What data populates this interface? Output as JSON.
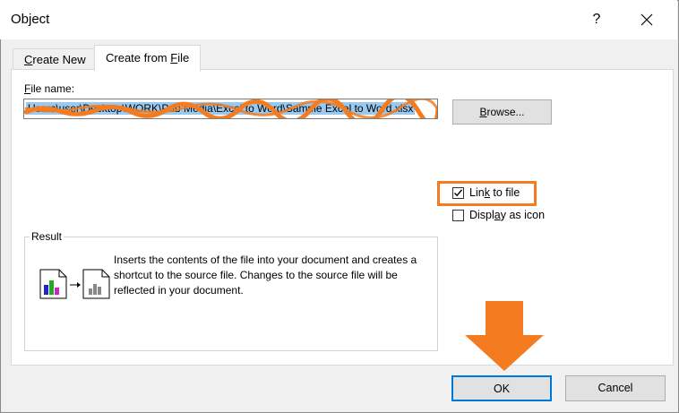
{
  "window": {
    "title": "Object",
    "help_label": "?",
    "close_icon": "close-icon"
  },
  "tabs": [
    {
      "label": "Create New",
      "accel": "C",
      "rest": "reate New",
      "active": false
    },
    {
      "label": "Create from File",
      "accel_pre": "Create from ",
      "accel": "F",
      "rest": "ile",
      "active": true
    }
  ],
  "file": {
    "label_pre": "",
    "label_accel": "F",
    "label_rest": "ile name:",
    "value": "Users\\user\\Desktop\\WORK\\Pub Media\\Excel to Word\\Sample Excel to Word.xlsx",
    "browse_pre": "",
    "browse_accel": "B",
    "browse_rest": "rowse..."
  },
  "options": {
    "link": {
      "pre": "Lin",
      "accel": "k",
      "rest": " to file",
      "checked": true
    },
    "display_icon": {
      "pre": "Displ",
      "accel": "a",
      "rest": "y as icon",
      "checked": false
    }
  },
  "result": {
    "label": "Result",
    "text": "Inserts the contents of the file into your document and creates a shortcut to the source file.  Changes to the source file will be reflected in your document."
  },
  "buttons": {
    "ok": "OK",
    "cancel": "Cancel"
  },
  "colors": {
    "accent_highlight": "#f47b20",
    "focus_border": "#0078d7",
    "selection": "#99c9ef"
  }
}
